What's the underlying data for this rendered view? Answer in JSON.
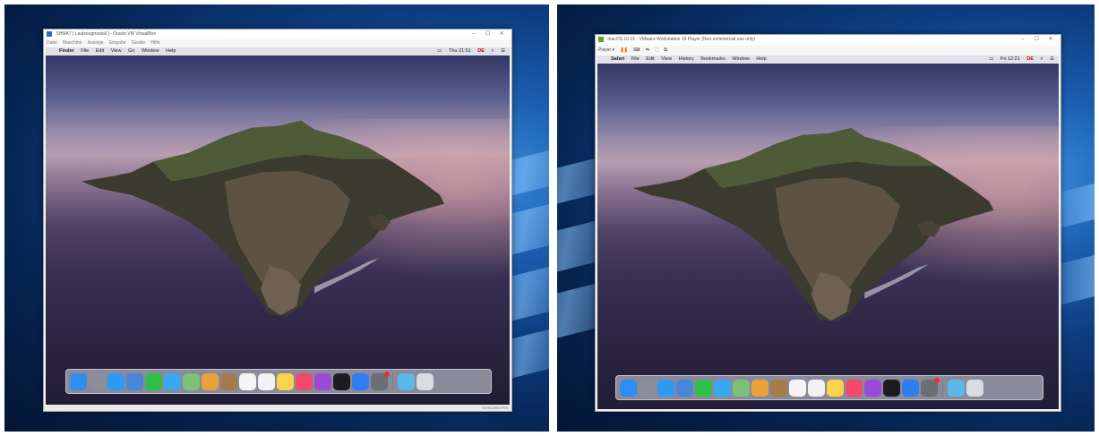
{
  "colors": {
    "win_blue": "#1b5fb0",
    "pause": "#e06a00",
    "badge": "#e53030"
  },
  "left": {
    "window_title": "SHMA7 [ Laufzeugmodell ] - Oracle VM VirtualBox",
    "host_menu": [
      "Datei",
      "Maschine",
      "Anzeige",
      "Eingabe",
      "Geräte",
      "Hilfe"
    ],
    "mac_menu": {
      "apple": "",
      "app": "Finder",
      "items": [
        "File",
        "Edit",
        "View",
        "Go",
        "Window",
        "Help"
      ],
      "clock": "Thu 21:51",
      "flag": "DE"
    },
    "status_text": "STRG-RECHTS"
  },
  "right": {
    "window_title": "macOS 10.15 - VMware Workstation 15 Player (Non-commercial use only)",
    "toolbar": {
      "player": "Player ▾",
      "pause": "❚❚"
    },
    "mac_menu": {
      "apple": "",
      "app": "Safari",
      "items": [
        "File",
        "Edit",
        "View",
        "History",
        "Bookmarks",
        "Window",
        "Help"
      ],
      "clock": "Fri 12:21",
      "flag": "DE"
    }
  },
  "dock_icons": [
    {
      "name": "finder-icon",
      "color": "#2f8ef0"
    },
    {
      "name": "launchpad-icon",
      "color": "#8a8f99"
    },
    {
      "name": "safari-icon",
      "color": "#2e9bf2"
    },
    {
      "name": "mail-icon",
      "color": "#4a86d8"
    },
    {
      "name": "facetime-icon",
      "color": "#2fbf4a"
    },
    {
      "name": "messages-icon",
      "color": "#3aa7f5"
    },
    {
      "name": "maps-icon",
      "color": "#7cc07a"
    },
    {
      "name": "photos-icon",
      "color": "#e8a23a"
    },
    {
      "name": "contacts-icon",
      "color": "#a57b4a"
    },
    {
      "name": "calendar-icon",
      "color": "#f5f5f5"
    },
    {
      "name": "reminders-icon",
      "color": "#f2f2f2"
    },
    {
      "name": "notes-icon",
      "color": "#f7d54a"
    },
    {
      "name": "music-icon",
      "color": "#f24a6a"
    },
    {
      "name": "podcasts-icon",
      "color": "#9b4ad8"
    },
    {
      "name": "tv-icon",
      "color": "#1d1d1f"
    },
    {
      "name": "app-store-icon",
      "color": "#2f7ef0"
    },
    {
      "name": "system-preferences-icon",
      "color": "#6a6e75"
    },
    {
      "name": "downloads-folder-icon",
      "color": "#5cb8ea"
    },
    {
      "name": "trash-icon",
      "color": "#d9dde2"
    }
  ]
}
